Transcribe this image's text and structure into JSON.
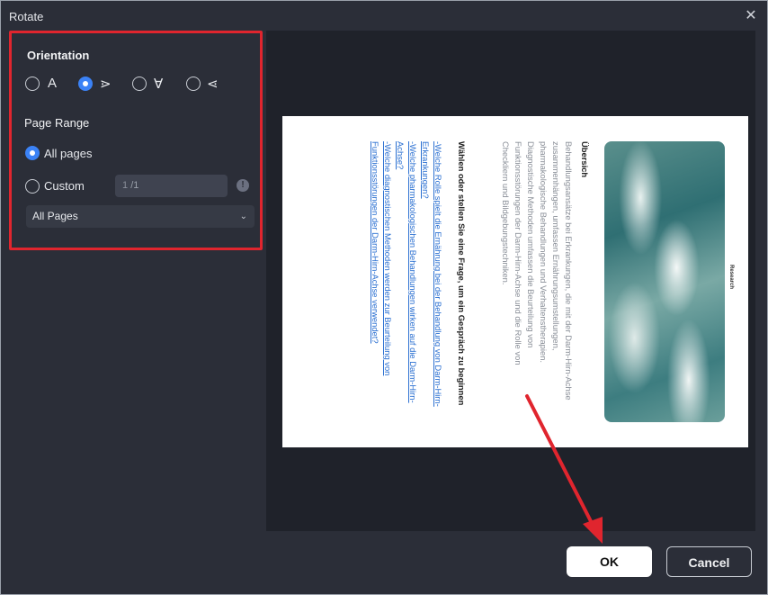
{
  "dialog": {
    "title": "Rotate",
    "close_glyph": "✕"
  },
  "orientation": {
    "label": "Orientation",
    "options": [
      {
        "glyph": "A",
        "selected": false
      },
      {
        "glyph": "⋗",
        "selected": true
      },
      {
        "glyph": "∀",
        "selected": false
      },
      {
        "glyph": "⋖",
        "selected": false
      }
    ]
  },
  "page_range": {
    "label": "Page Range",
    "all_pages_label": "All pages",
    "custom_label": "Custom",
    "custom_value": "1",
    "custom_total": "/1",
    "info_glyph": "!",
    "dropdown_value": "All Pages",
    "dropdown_chevron": "⌄"
  },
  "preview": {
    "col1_title": "Übersich",
    "col1_lines": [
      "Behandlungsansätze bei Erkrankungen, die mit der Darm-Hirn-Achse",
      "zusammenhängen, umfassen Ernährungsumstellungen,",
      "pharmakologische Behandlungen und Verhaltenstherapien.",
      "Diagnostische Methoden umfassen die Beurteilung von",
      "Funktionsstörungen der Darm-Hirn-Achse und die Rolle von",
      "Checkliern und Bildgebungstechniken."
    ],
    "col2_title": "Wählen oder stellen Sie eine Frage, um ein Gespräch zu beginnen",
    "col2_links": [
      "-Welche Rolle spielt die Ernährung bei der Behandlung von Darm-Hirn-",
      "Erkrankungen?",
      "-Welche pharmakologischen Behandlungen wirken auf die Darm-Hirn-",
      "Achse?",
      "-Welche diagnostischen Methoden werden zur Beurteilung von",
      "Funktionsstörungen der Darm-Hirn-Achse verwendet?"
    ],
    "photo_caption": "Research"
  },
  "buttons": {
    "ok": "OK",
    "cancel": "Cancel"
  },
  "colors": {
    "highlight": "#e0252e",
    "accent": "#3b82f6"
  }
}
